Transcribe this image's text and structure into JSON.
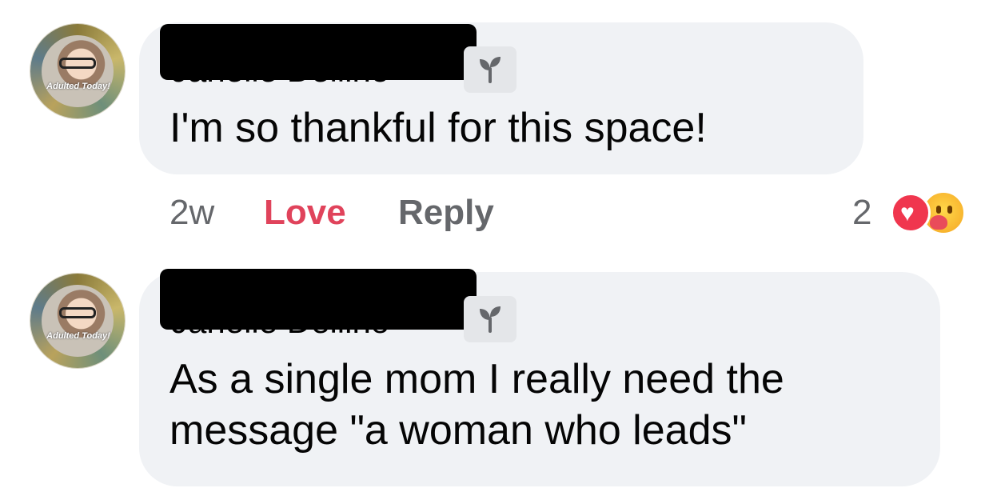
{
  "comments": [
    {
      "author_visible": "Janelle Dellino",
      "text": "I'm so thankful for this space!",
      "time": "2w",
      "love_label": "Love",
      "reply_label": "Reply",
      "reaction_count": "2",
      "reactions": [
        "heart-icon",
        "care-icon"
      ],
      "avatar_caption": "Adulted Today!"
    },
    {
      "author_visible": "Janelle Dellino",
      "text": "As a single mom I really need the\nmessage \"a woman who leads\"",
      "avatar_caption": "Adulted Today!"
    }
  ],
  "colors": {
    "bubble": "#f0f2f5",
    "love": "#e0435b",
    "meta": "#65676b",
    "heart": "#f0364e"
  }
}
